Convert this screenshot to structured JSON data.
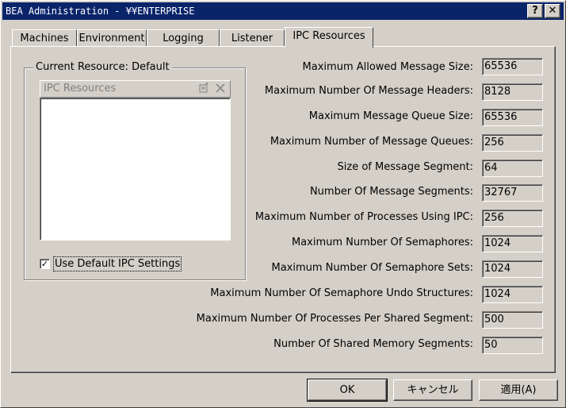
{
  "window": {
    "title": "BEA Administration - ¥¥ENTERPRISE",
    "help_glyph": "?",
    "close_glyph": "✕"
  },
  "tabs": [
    {
      "label": "Machines"
    },
    {
      "label": "Environment"
    },
    {
      "label": "Logging"
    },
    {
      "label": "Listener"
    },
    {
      "label": "IPC Resources"
    }
  ],
  "resource_group": {
    "legend": "Current Resource: Default",
    "list_header": "IPC Resources",
    "new_icon": "new-item-icon",
    "delete_icon": "delete-icon",
    "use_default_checked": true,
    "use_default_label": "Use Default IPC Settings"
  },
  "fields": [
    {
      "label": "Maximum Allowed Message Size:",
      "value": "65536"
    },
    {
      "label": "Maximum Number Of Message Headers:",
      "value": "8128"
    },
    {
      "label": "Maximum Message Queue Size:",
      "value": "65536"
    },
    {
      "label": "Maximum Number of Message Queues:",
      "value": "256"
    },
    {
      "label": "Size of Message Segment:",
      "value": "64"
    },
    {
      "label": "Number Of Message Segments:",
      "value": "32767"
    },
    {
      "label": "Maximum Number of Processes Using IPC:",
      "value": "256"
    },
    {
      "label": "Maximum Number Of Semaphores:",
      "value": "1024"
    },
    {
      "label": "Maximum Number Of Semaphore Sets:",
      "value": "1024"
    },
    {
      "label": "Maximum Number Of Semaphore Undo Structures:",
      "value": "1024"
    },
    {
      "label": "Maximum Number Of Processes Per Shared Segment:",
      "value": "500"
    },
    {
      "label": "Number Of Shared Memory Segments:",
      "value": "50"
    }
  ],
  "buttons": {
    "ok": "OK",
    "cancel": "キャンセル",
    "apply": "適用(A)"
  }
}
